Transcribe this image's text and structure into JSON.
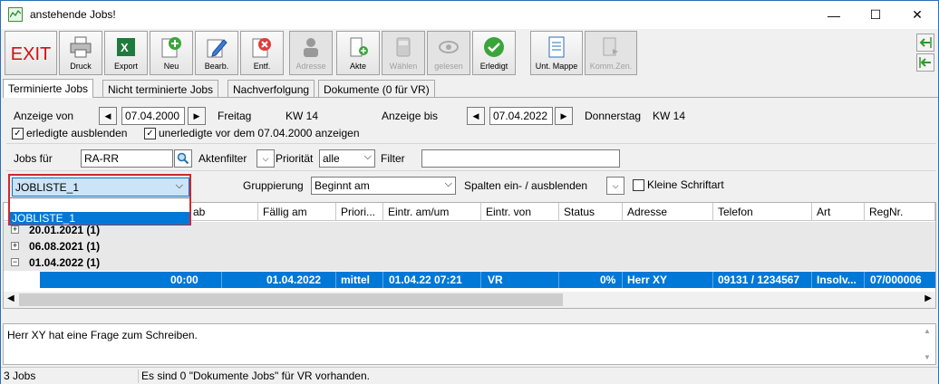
{
  "window": {
    "title": "anstehende Jobs!",
    "minimize": "—",
    "maximize": "☐",
    "close": "✕"
  },
  "toolbar": {
    "exit": "EXIT",
    "druck": "Druck",
    "export": "Export",
    "neu": "Neu",
    "bearb": "Bearb.",
    "entf": "Entf.",
    "adresse": "Adresse",
    "akte": "Akte",
    "waehlen": "Wählen",
    "gelesen": "gelesen",
    "erledigt": "Erledigt",
    "unt_mappe": "Unt. Mappe",
    "komm_zen": "Komm.Zen."
  },
  "tabs": [
    "Terminierte Jobs",
    "Nicht terminierte Jobs",
    "Nachverfolgung",
    "Dokumente (0 für VR)"
  ],
  "filters": {
    "anzeige_von_label": "Anzeige von",
    "anzeige_von_value": "07.04.2000",
    "anzeige_von_day": "Freitag",
    "anzeige_von_kw": "KW 14",
    "anzeige_bis_label": "Anzeige bis",
    "anzeige_bis_value": "07.04.2022",
    "anzeige_bis_day": "Donnerstag",
    "anzeige_bis_kw": "KW 14",
    "erledigte_label": "erledigte ausblenden",
    "erledigte_checked": true,
    "unerledigte_label": "unerledigte vor dem 07.04.2000 anzeigen",
    "unerledigte_checked": true,
    "jobs_fuer_label": "Jobs für",
    "jobs_fuer_value": "RA-RR",
    "aktenfilter_label": "Aktenfilter",
    "prioritaet_label": "Priorität",
    "prioritaet_value": "alle",
    "filter_label": "Filter",
    "filter_value": "",
    "gruppierung_label": "Gruppierung",
    "gruppierung_value": "Beginnt am",
    "spalten_label": "Spalten ein- / ausblenden",
    "kleine_schrift_label": "Kleine Schriftart",
    "kleine_schrift_checked": false
  },
  "jobliste": {
    "selected": "JOBLISTE_1",
    "options": [
      "JOBLISTE_1"
    ]
  },
  "grid": {
    "columns": [
      "ab",
      "Fällig am",
      "Priori...",
      "Eintr. am/um",
      "Eintr. von",
      "Status",
      "Adresse",
      "Telefon",
      "Art",
      "RegNr."
    ],
    "groups": [
      {
        "label": "20.01.2021 (1)",
        "expanded": false
      },
      {
        "label": "06.08.2021 (1)",
        "expanded": false
      },
      {
        "label": "01.04.2022 (1)",
        "expanded": true
      }
    ],
    "selected_row": {
      "ab": "00:00",
      "faellig": "01.04.2022",
      "prioritaet": "mittel",
      "eintr_am": "01.04.22 07:21",
      "eintr_von": "VR",
      "status": "0%",
      "adresse": "Herr XY",
      "telefon": "09131 / 1234567",
      "art": "Insolv...",
      "regnr": "07/000006"
    }
  },
  "memo": {
    "text": "Herr XY hat eine Frage zum Schreiben."
  },
  "statusbar": {
    "count": "3 Jobs",
    "message": "Es sind 0 \"Dokumente Jobs\" für VR vorhanden."
  }
}
